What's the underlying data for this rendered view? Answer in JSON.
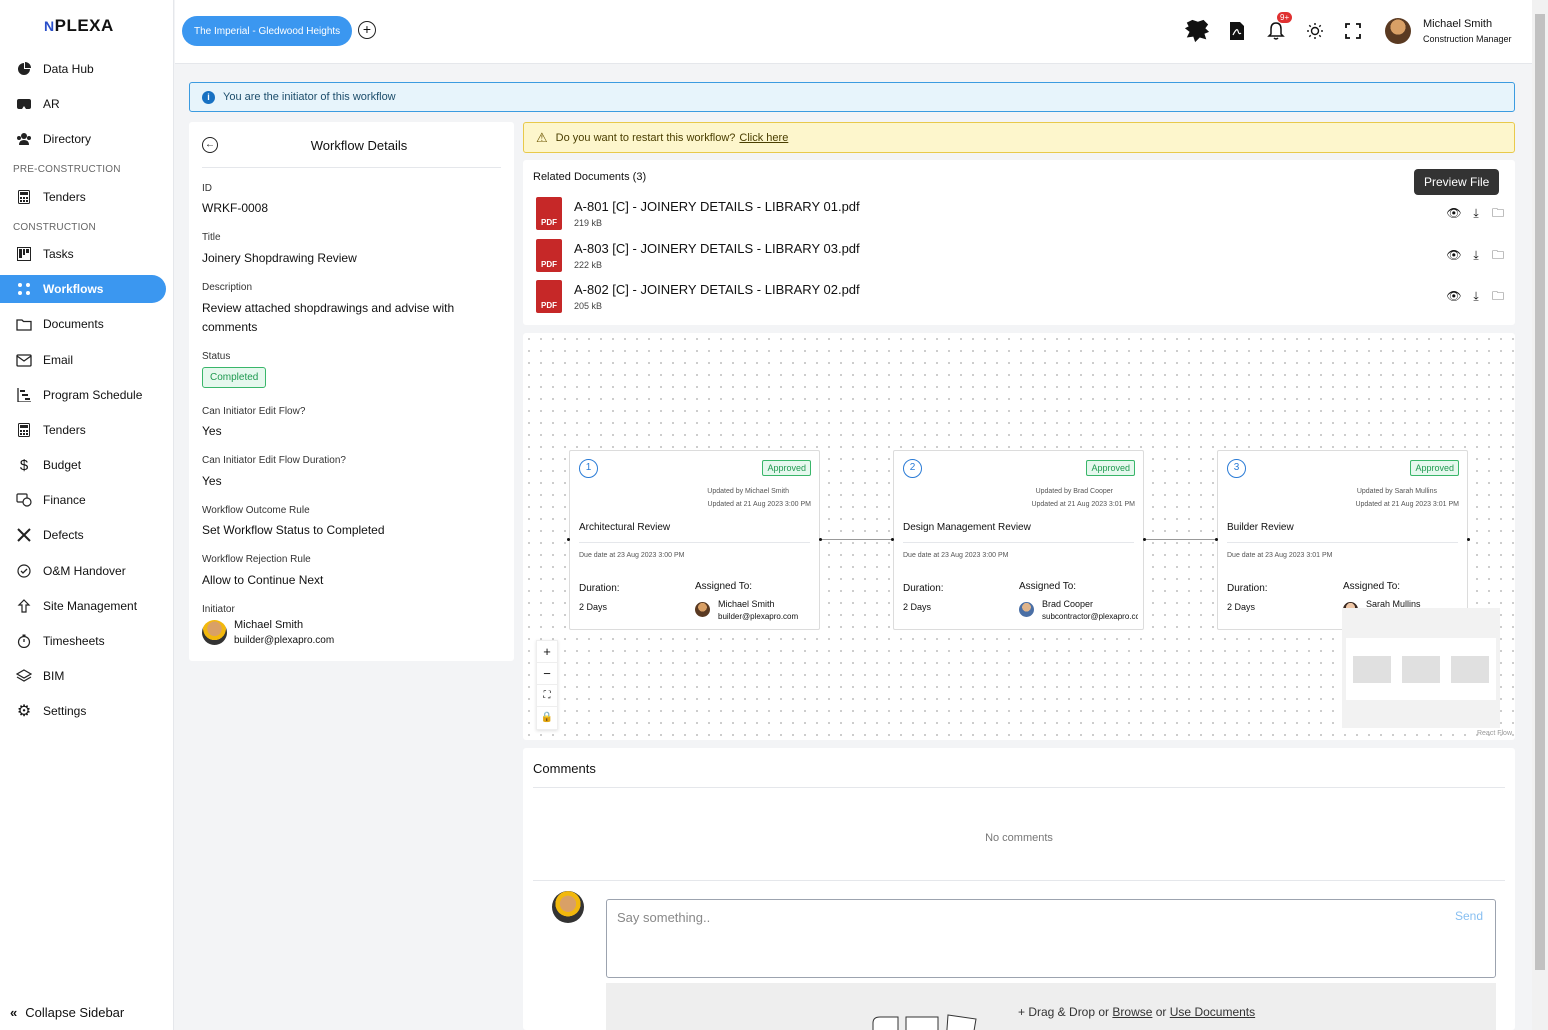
{
  "brand": {
    "logo_mark": "N",
    "logo_text": "PLEXA"
  },
  "sidebar": {
    "items": [
      {
        "label": "Data Hub",
        "icon": "pie-chart-icon"
      },
      {
        "label": "AR",
        "icon": "vr-headset-icon"
      },
      {
        "label": "Directory",
        "icon": "people-icon"
      },
      {
        "label": "Tenders",
        "icon": "calculator-icon"
      },
      {
        "label": "Tasks",
        "icon": "kanban-icon"
      },
      {
        "label": "Workflows",
        "icon": "workflow-icon"
      },
      {
        "label": "Documents",
        "icon": "folder-icon"
      },
      {
        "label": "Email",
        "icon": "envelope-icon"
      },
      {
        "label": "Program Schedule",
        "icon": "gantt-icon"
      },
      {
        "label": "Tenders",
        "icon": "calculator-icon"
      },
      {
        "label": "Budget",
        "icon": "dollar-icon"
      },
      {
        "label": "Finance",
        "icon": "finance-icon"
      },
      {
        "label": "Defects",
        "icon": "tools-icon"
      },
      {
        "label": "O&M Handover",
        "icon": "check-circle-icon"
      },
      {
        "label": "Site Management",
        "icon": "site-icon"
      },
      {
        "label": "Timesheets",
        "icon": "stopwatch-icon"
      },
      {
        "label": "BIM",
        "icon": "layers-icon"
      },
      {
        "label": "Settings",
        "icon": "gear-icon"
      }
    ],
    "sections": {
      "pre_construction": "PRE-CONSTRUCTION",
      "construction": "CONSTRUCTION"
    },
    "collapse_label": "Collapse Sidebar",
    "active_color": "#3b97f0"
  },
  "topbar": {
    "project": "The Imperial - Gledwood Heights",
    "notification_count": "9+",
    "user_name": "Michael Smith",
    "user_role": "Construction Manager"
  },
  "info_banner": "You are the initiator of this workflow",
  "details": {
    "title": "Workflow Details",
    "id_label": "ID",
    "id": "WRKF-0008",
    "title_label": "Title",
    "title_value": "Joinery Shopdrawing Review",
    "description_label": "Description",
    "description": "Review attached shopdrawings and advise with comments",
    "status_label": "Status",
    "status": "Completed",
    "edit_flow_label": "Can Initiator Edit Flow?",
    "edit_flow": "Yes",
    "edit_duration_label": "Can Initiator Edit Flow Duration?",
    "edit_duration": "Yes",
    "outcome_label": "Workflow Outcome Rule",
    "outcome": "Set Workflow Status to Completed",
    "rejection_label": "Workflow Rejection Rule",
    "rejection": "Allow to Continue Next",
    "initiator_label": "Initiator",
    "initiator_name": "Michael Smith",
    "initiator_email": "builder@plexapro.com"
  },
  "warning": {
    "text": "Do you want to restart this workflow?",
    "link": "Click here"
  },
  "documents": {
    "header": "Related Documents (3)",
    "tooltip": "Preview File",
    "items": [
      {
        "name": "A-801 [C] - JOINERY DETAILS - LIBRARY 01.pdf",
        "size": "219 kB",
        "type": "PDF"
      },
      {
        "name": "A-803 [C] - JOINERY DETAILS - LIBRARY 03.pdf",
        "size": "222 kB",
        "type": "PDF"
      },
      {
        "name": "A-802 [C] - JOINERY DETAILS - LIBRARY 02.pdf",
        "size": "205 kB",
        "type": "PDF"
      }
    ]
  },
  "flow": {
    "nodes": [
      {
        "num": "1",
        "status": "Approved",
        "updated_by": "Updated by Michael Smith",
        "updated_at": "Updated at 21 Aug 2023 3:00 PM",
        "name": "Architectural Review",
        "due": "Due date at 23 Aug 2023 3:00 PM",
        "duration_label": "Duration:",
        "duration": "2 Days",
        "assigned_label": "Assigned To:",
        "assignee": "Michael Smith",
        "assignee_email": "builder@plexapro.com"
      },
      {
        "num": "2",
        "status": "Approved",
        "updated_by": "Updated by Brad Cooper",
        "updated_at": "Updated at 21 Aug 2023 3:01 PM",
        "name": "Design Management Review",
        "due": "Due date at 23 Aug 2023 3:00 PM",
        "duration_label": "Duration:",
        "duration": "2 Days",
        "assigned_label": "Assigned To:",
        "assignee": "Brad Cooper",
        "assignee_email": "subcontractor@plexapro.cc"
      },
      {
        "num": "3",
        "status": "Approved",
        "updated_by": "Updated by Sarah Mullins",
        "updated_at": "Updated at 21 Aug 2023 3:01 PM",
        "name": "Builder Review",
        "due": "Due date at 23 Aug 2023 3:01 PM",
        "duration_label": "Duration:",
        "duration": "2 Days",
        "assigned_label": "Assigned To:",
        "assignee": "Sarah Mullins",
        "assignee_email": ""
      }
    ],
    "attribution": "React Flow"
  },
  "comments": {
    "title": "Comments",
    "empty": "No comments",
    "placeholder": "Say something..",
    "send": "Send",
    "drop_prefix": "+ Drag & Drop or",
    "browse": "Browse",
    "or": "or",
    "use_documents": "Use Documents"
  }
}
